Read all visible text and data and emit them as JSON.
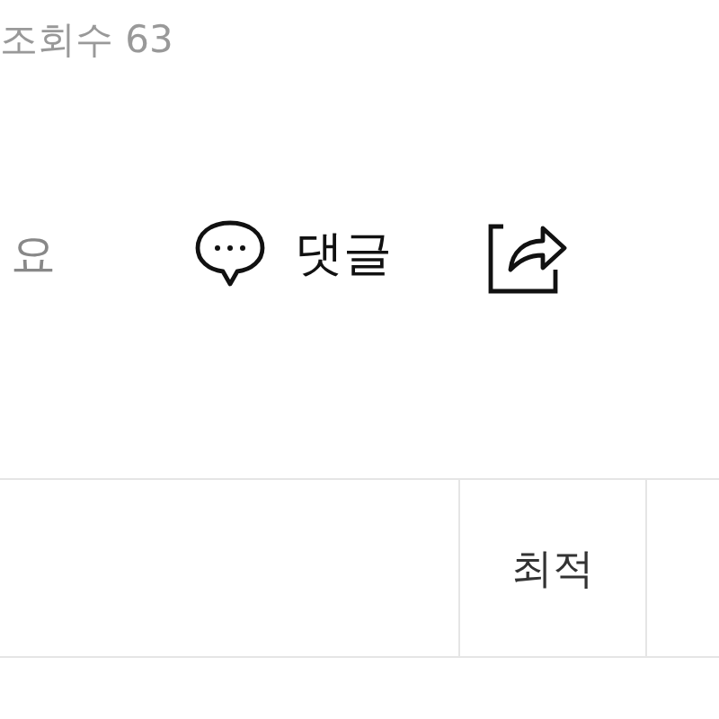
{
  "post_meta": {
    "views": "조회수 63"
  },
  "actions": [
    {
      "kind": "text",
      "label": "요"
    },
    {
      "kind": "comment",
      "label": "댓글"
    },
    {
      "kind": "share"
    }
  ],
  "sort_tabs": [
    {
      "label": "최적",
      "selected": true
    }
  ]
}
